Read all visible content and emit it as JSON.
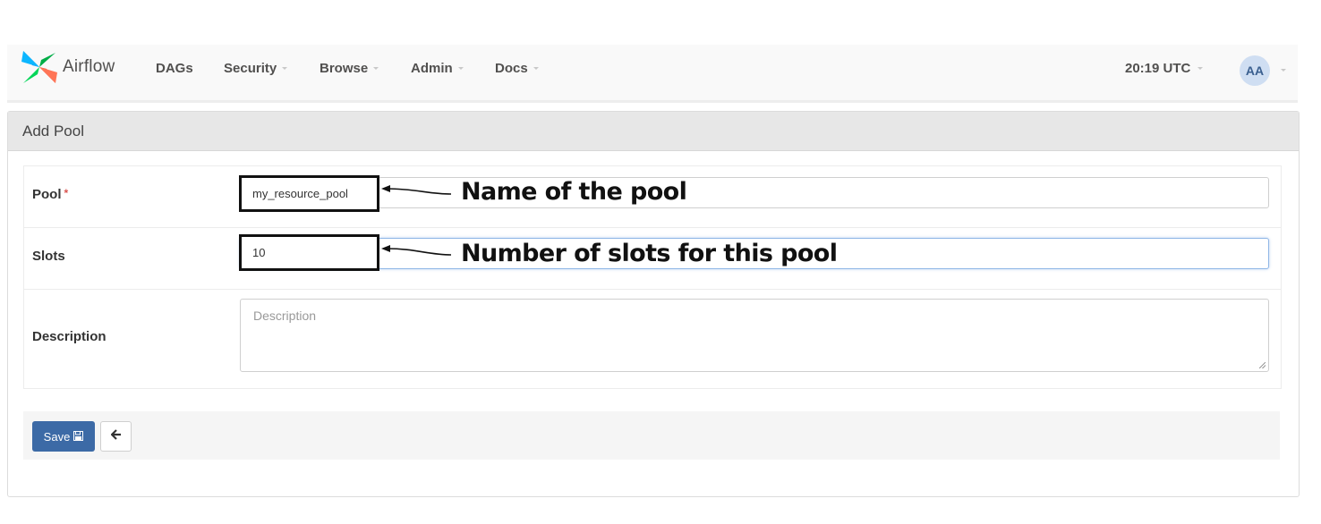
{
  "navbar": {
    "brand": "Airflow",
    "menu": [
      {
        "label": "DAGs",
        "has_caret": false
      },
      {
        "label": "Security",
        "has_caret": true
      },
      {
        "label": "Browse",
        "has_caret": true
      },
      {
        "label": "Admin",
        "has_caret": true
      },
      {
        "label": "Docs",
        "has_caret": true
      }
    ],
    "clock": "20:19 UTC",
    "user_initials": "AA"
  },
  "panel": {
    "title": "Add Pool",
    "fields": {
      "pool": {
        "label": "Pool",
        "required_marker": "*",
        "value": "my_resource_pool"
      },
      "slots": {
        "label": "Slots",
        "value": "10"
      },
      "description": {
        "label": "Description",
        "placeholder": "Description",
        "value": ""
      }
    },
    "buttons": {
      "save": "Save"
    }
  },
  "annotations": [
    {
      "target": "pool",
      "text": "Name of the pool"
    },
    {
      "target": "slots",
      "text": "Number of slots for this pool"
    }
  ],
  "colors": {
    "primary_button": "#3c6aa6",
    "required": "#d9534f",
    "focus_border": "#8fb6e6"
  },
  "icons": {
    "brand": "airflow-pinwheel-icon",
    "save": "floppy-disk-icon",
    "back": "arrow-left-icon"
  }
}
